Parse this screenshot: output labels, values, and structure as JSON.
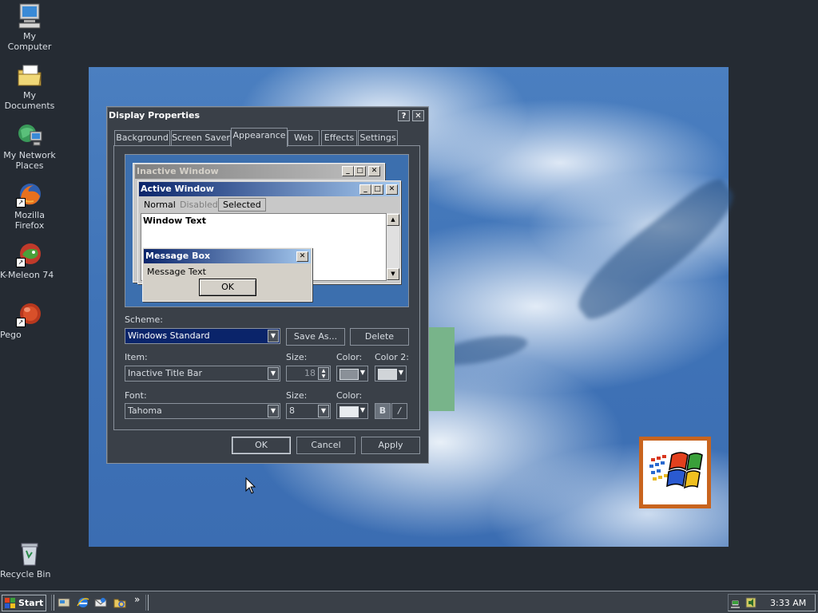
{
  "desktop": {
    "icons": [
      {
        "label": "My Computer"
      },
      {
        "label": "My Documents"
      },
      {
        "label": "My Network Places"
      },
      {
        "label": "Mozilla Firefox"
      },
      {
        "label": "K-Meleon 74"
      },
      {
        "label": "Pego"
      },
      {
        "label": "Recycle Bin"
      }
    ],
    "shortcut_glyph": "↗"
  },
  "dialog": {
    "title": "Display Properties",
    "help_glyph": "?",
    "close_glyph": "✕",
    "tabs": [
      {
        "label": "Background"
      },
      {
        "label": "Screen Saver"
      },
      {
        "label": "Appearance"
      },
      {
        "label": "Web"
      },
      {
        "label": "Effects"
      },
      {
        "label": "Settings"
      }
    ],
    "active_tab": "Appearance",
    "preview": {
      "inactive_window_title": "Inactive Window",
      "active_window_title": "Active Window",
      "menu_normal": "Normal",
      "menu_disabled": "Disabled",
      "menu_selected": "Selected",
      "window_text": "Window Text",
      "message_box_title": "Message Box",
      "message_text": "Message Text",
      "ok_label": "OK",
      "min_glyph": "_",
      "max_glyph": "□",
      "close_glyph": "✕",
      "scroll_up_glyph": "▲",
      "scroll_down_glyph": "▼"
    },
    "scheme_label": "Scheme:",
    "scheme_value": "Windows Standard",
    "save_as_label": "Save As...",
    "delete_label": "Delete",
    "item_label": "Item:",
    "item_value": "Inactive Title Bar",
    "size_label": "Size:",
    "item_size_value": "18",
    "color_label": "Color:",
    "color2_label": "Color 2:",
    "font_label": "Font:",
    "font_value": "Tahoma",
    "font_size_label": "Size:",
    "font_size_value": "8",
    "font_color_label": "Color:",
    "bold_label": "B",
    "italic_label": "/",
    "dropdown_glyph": "▼",
    "ok_label": "OK",
    "cancel_label": "Cancel",
    "apply_label": "Apply",
    "colors": {
      "item_color": "#8a9098",
      "item_color2": "#d0d4d8",
      "font_color": "#e8ecef"
    }
  },
  "taskbar": {
    "start_label": "Start",
    "quicklaunch_more": "»",
    "clock": "3:33 AM"
  }
}
